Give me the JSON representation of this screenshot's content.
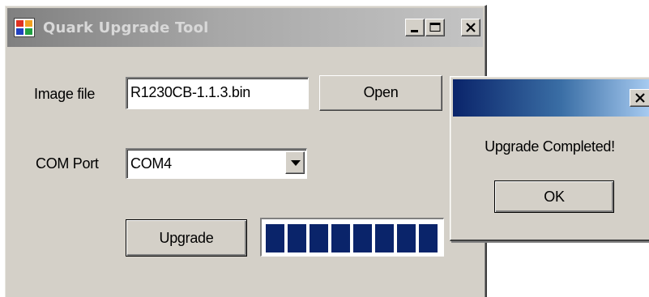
{
  "window": {
    "title": "Quark Upgrade Tool",
    "icon": "app-window-icon",
    "controls": [
      "minimize-icon",
      "maximize-icon",
      "close-icon"
    ]
  },
  "form": {
    "image_file_label": "Image file",
    "image_file_value": "R1230CB-1.1.3.bin",
    "open_label": "Open",
    "com_port_label": "COM Port",
    "com_port_value": "COM4",
    "upgrade_label": "Upgrade",
    "progress_percent": 100
  },
  "dialog": {
    "title": "",
    "message": "Upgrade Completed!",
    "ok_label": "OK"
  },
  "colors": {
    "face": "#d4d0c8",
    "progress": "#0a246a",
    "inactive_title": "#808080",
    "active_title_start": "#0a246a",
    "active_title_end": "#a6caf0"
  }
}
